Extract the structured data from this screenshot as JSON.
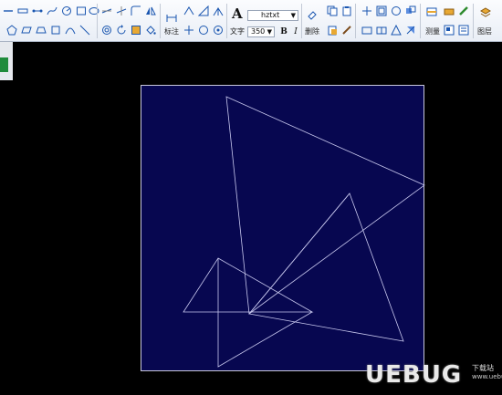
{
  "toolbar": {
    "font_name": "hztxt",
    "font_size": "350",
    "label_annotate": "标注",
    "label_text": "文字",
    "label_delete": "删除",
    "label_measure": "测量",
    "label_layer": "图层",
    "bold": "B",
    "italic": "I",
    "text_big_icon": "A"
  },
  "watermark": {
    "logo": "UEBUG",
    "subtitle": "下载站",
    "url": "www.uebug.com"
  },
  "colors": {
    "canvas_bg": "#070750",
    "line": "#c8c8ee",
    "app_bg": "#000000"
  }
}
